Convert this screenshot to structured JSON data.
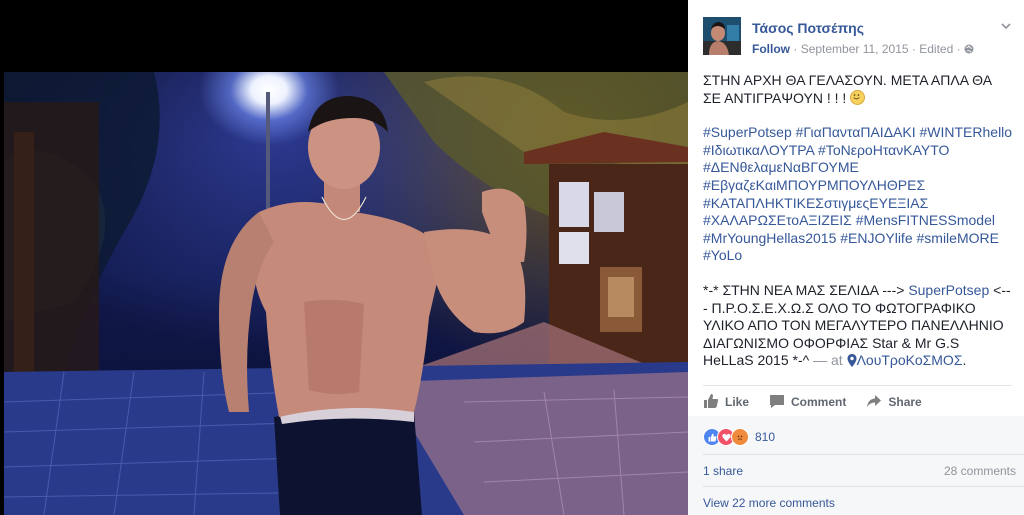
{
  "post": {
    "author": "Τάσος Ποτσέπης",
    "follow_label": "Follow",
    "date": "September 11, 2015",
    "edited": "Edited",
    "meta_separator": "·",
    "text_line1": "ΣΤΗΝ ΑΡΧΗ ΘΑ ΓΕΛΑΣΟΥΝ. ΜΕΤΑ ΑΠΛΑ ΘΑ ΣΕ ΑΝΤΙΓΡΑΨΟΥΝ ! ! !",
    "hashtags": [
      "#SuperPotsep",
      "#ΓιαΠανταΠΑΙΔΑΚΙ",
      "#WINTERhello",
      "#ΙδιωτικαΛΟΥΤΡΑ",
      "#ΤοΝεροΗτανΚΑΥΤΟ",
      "#ΔΕΝθελαμεΝαΒΓΟΥΜΕ",
      "#ΕβγαζεΚαιΜΠΟΥΡΜΠΟΥΛΗΘΡΕΣ",
      "#ΚΑΤΑΠΛΗΚΤΙΚΕΣστιγμεςΕΥΕΞΙΑΣ",
      "#ΧΑΛΑΡΩΣΕτοΑΞΙΖΕΙΣ",
      "#MensFITNESSmodel",
      "#MrYoungHellas2015",
      "#ENJOYlife",
      "#smileMORE",
      "#YoLo"
    ],
    "promo_prefix": "*-* ΣΤΗΝ ΝΕΑ ΜΑΣ ΣΕΛΙΔΑ --->",
    "promo_link": "SuperPotsep",
    "promo_suffix": "<--- Π.Ρ.Ο.Σ.Ε.Χ.Ω.Σ ΟΛΟ ΤΟ ΦΩΤΟΓΡΑΦΙΚΟ ΥΛΙΚΟ ΑΠΟ ΤΟΝ ΜΕΓΑΛΥΤΕΡΟ ΠΑΝΕΛΛΗΝΙΟ ΔΙΑΓΩΝΙΣΜΟ ΟΦΟΡΦΙΑΣ Star & Mr G.S HeLLaS 2015 *-^",
    "at_text": "— at",
    "location": "ΛουΤροΚοΣΜΟΣ",
    "location_end": "."
  },
  "actions": {
    "like": "Like",
    "comment": "Comment",
    "share": "Share"
  },
  "stats": {
    "reaction_count": "810",
    "shares": "1 share",
    "comments": "28 comments",
    "view_more": "View 22 more comments"
  },
  "icons": {
    "like": "thumbs-up-icon",
    "comment": "speech-bubble-icon",
    "share": "share-arrow-icon",
    "privacy": "globe-icon",
    "location": "map-pin-icon",
    "options": "chevron-down-icon"
  },
  "colors": {
    "link": "#365899",
    "muted": "#90949c",
    "like_reaction": "#4f85f0",
    "love_reaction": "#f25268",
    "angry_reaction": "#f08a3c"
  }
}
